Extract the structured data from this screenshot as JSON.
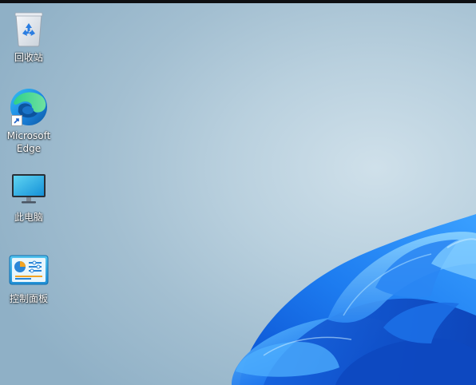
{
  "desktop": {
    "icons": [
      {
        "label": "回收站",
        "icon": "recycle-bin-icon"
      },
      {
        "label": "Microsoft\nEdge",
        "icon": "edge-icon",
        "shortcut": true
      },
      {
        "label": "此电脑",
        "icon": "monitor-icon"
      },
      {
        "label": "控制面板",
        "icon": "control-panel-icon"
      }
    ]
  },
  "colors": {
    "wallpaper_light": "#cfe0ea",
    "wallpaper_dark": "#8fb0c6",
    "bloom_blue": "#1a6fe0",
    "bloom_light": "#5db4ff",
    "topbar": "#0e0f12"
  }
}
